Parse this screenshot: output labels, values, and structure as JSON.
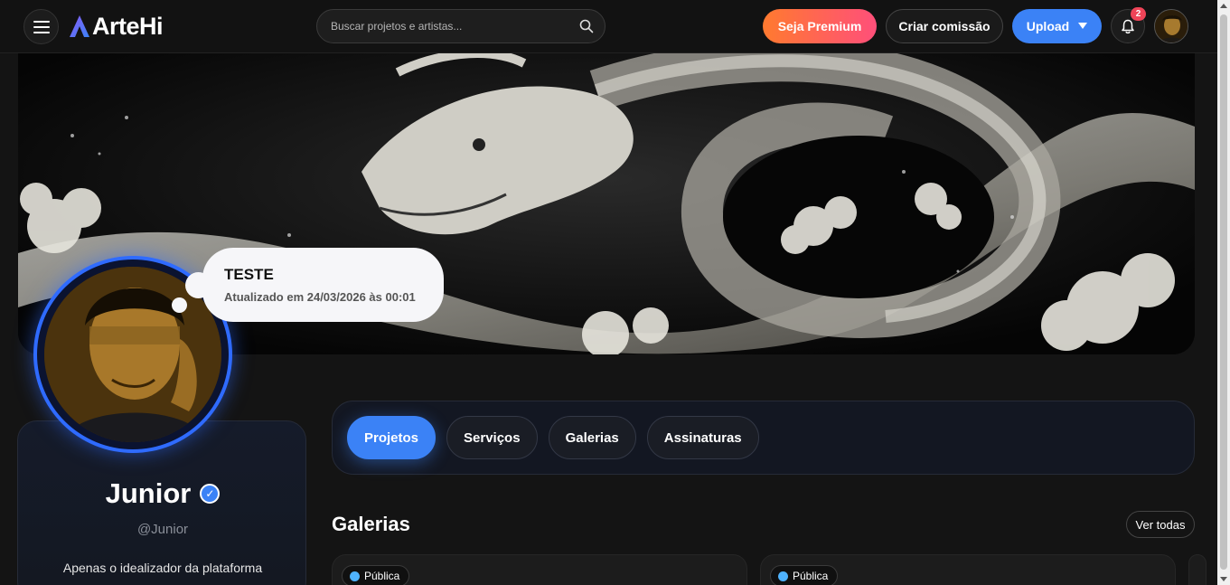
{
  "header": {
    "logo_text": "ArteHi",
    "search_placeholder": "Buscar projetos e artistas...",
    "premium_label": "Seja Premium",
    "commission_label": "Criar comissão",
    "upload_label": "Upload",
    "notification_count": "2"
  },
  "status_bubble": {
    "title": "TESTE",
    "updated": "Atualizado em 24/03/2026 às 00:01"
  },
  "profile": {
    "name": "Junior",
    "handle": "@Junior",
    "bio": "Apenas o idealizador da plataforma",
    "verified": true
  },
  "tabs": [
    {
      "label": "Projetos",
      "active": true
    },
    {
      "label": "Serviços",
      "active": false
    },
    {
      "label": "Galerias",
      "active": false
    },
    {
      "label": "Assinaturas",
      "active": false
    }
  ],
  "galleries": {
    "title": "Galerias",
    "see_all_label": "Ver todas",
    "cards": [
      {
        "visibility": "Pública"
      },
      {
        "visibility": "Pública"
      }
    ]
  },
  "colors": {
    "accent": "#3b82f6",
    "premium_gradient_start": "#ff7a2f",
    "premium_gradient_end": "#ff4f7a",
    "badge": "#ef4458",
    "avatar_ring": "#2f6bff"
  }
}
